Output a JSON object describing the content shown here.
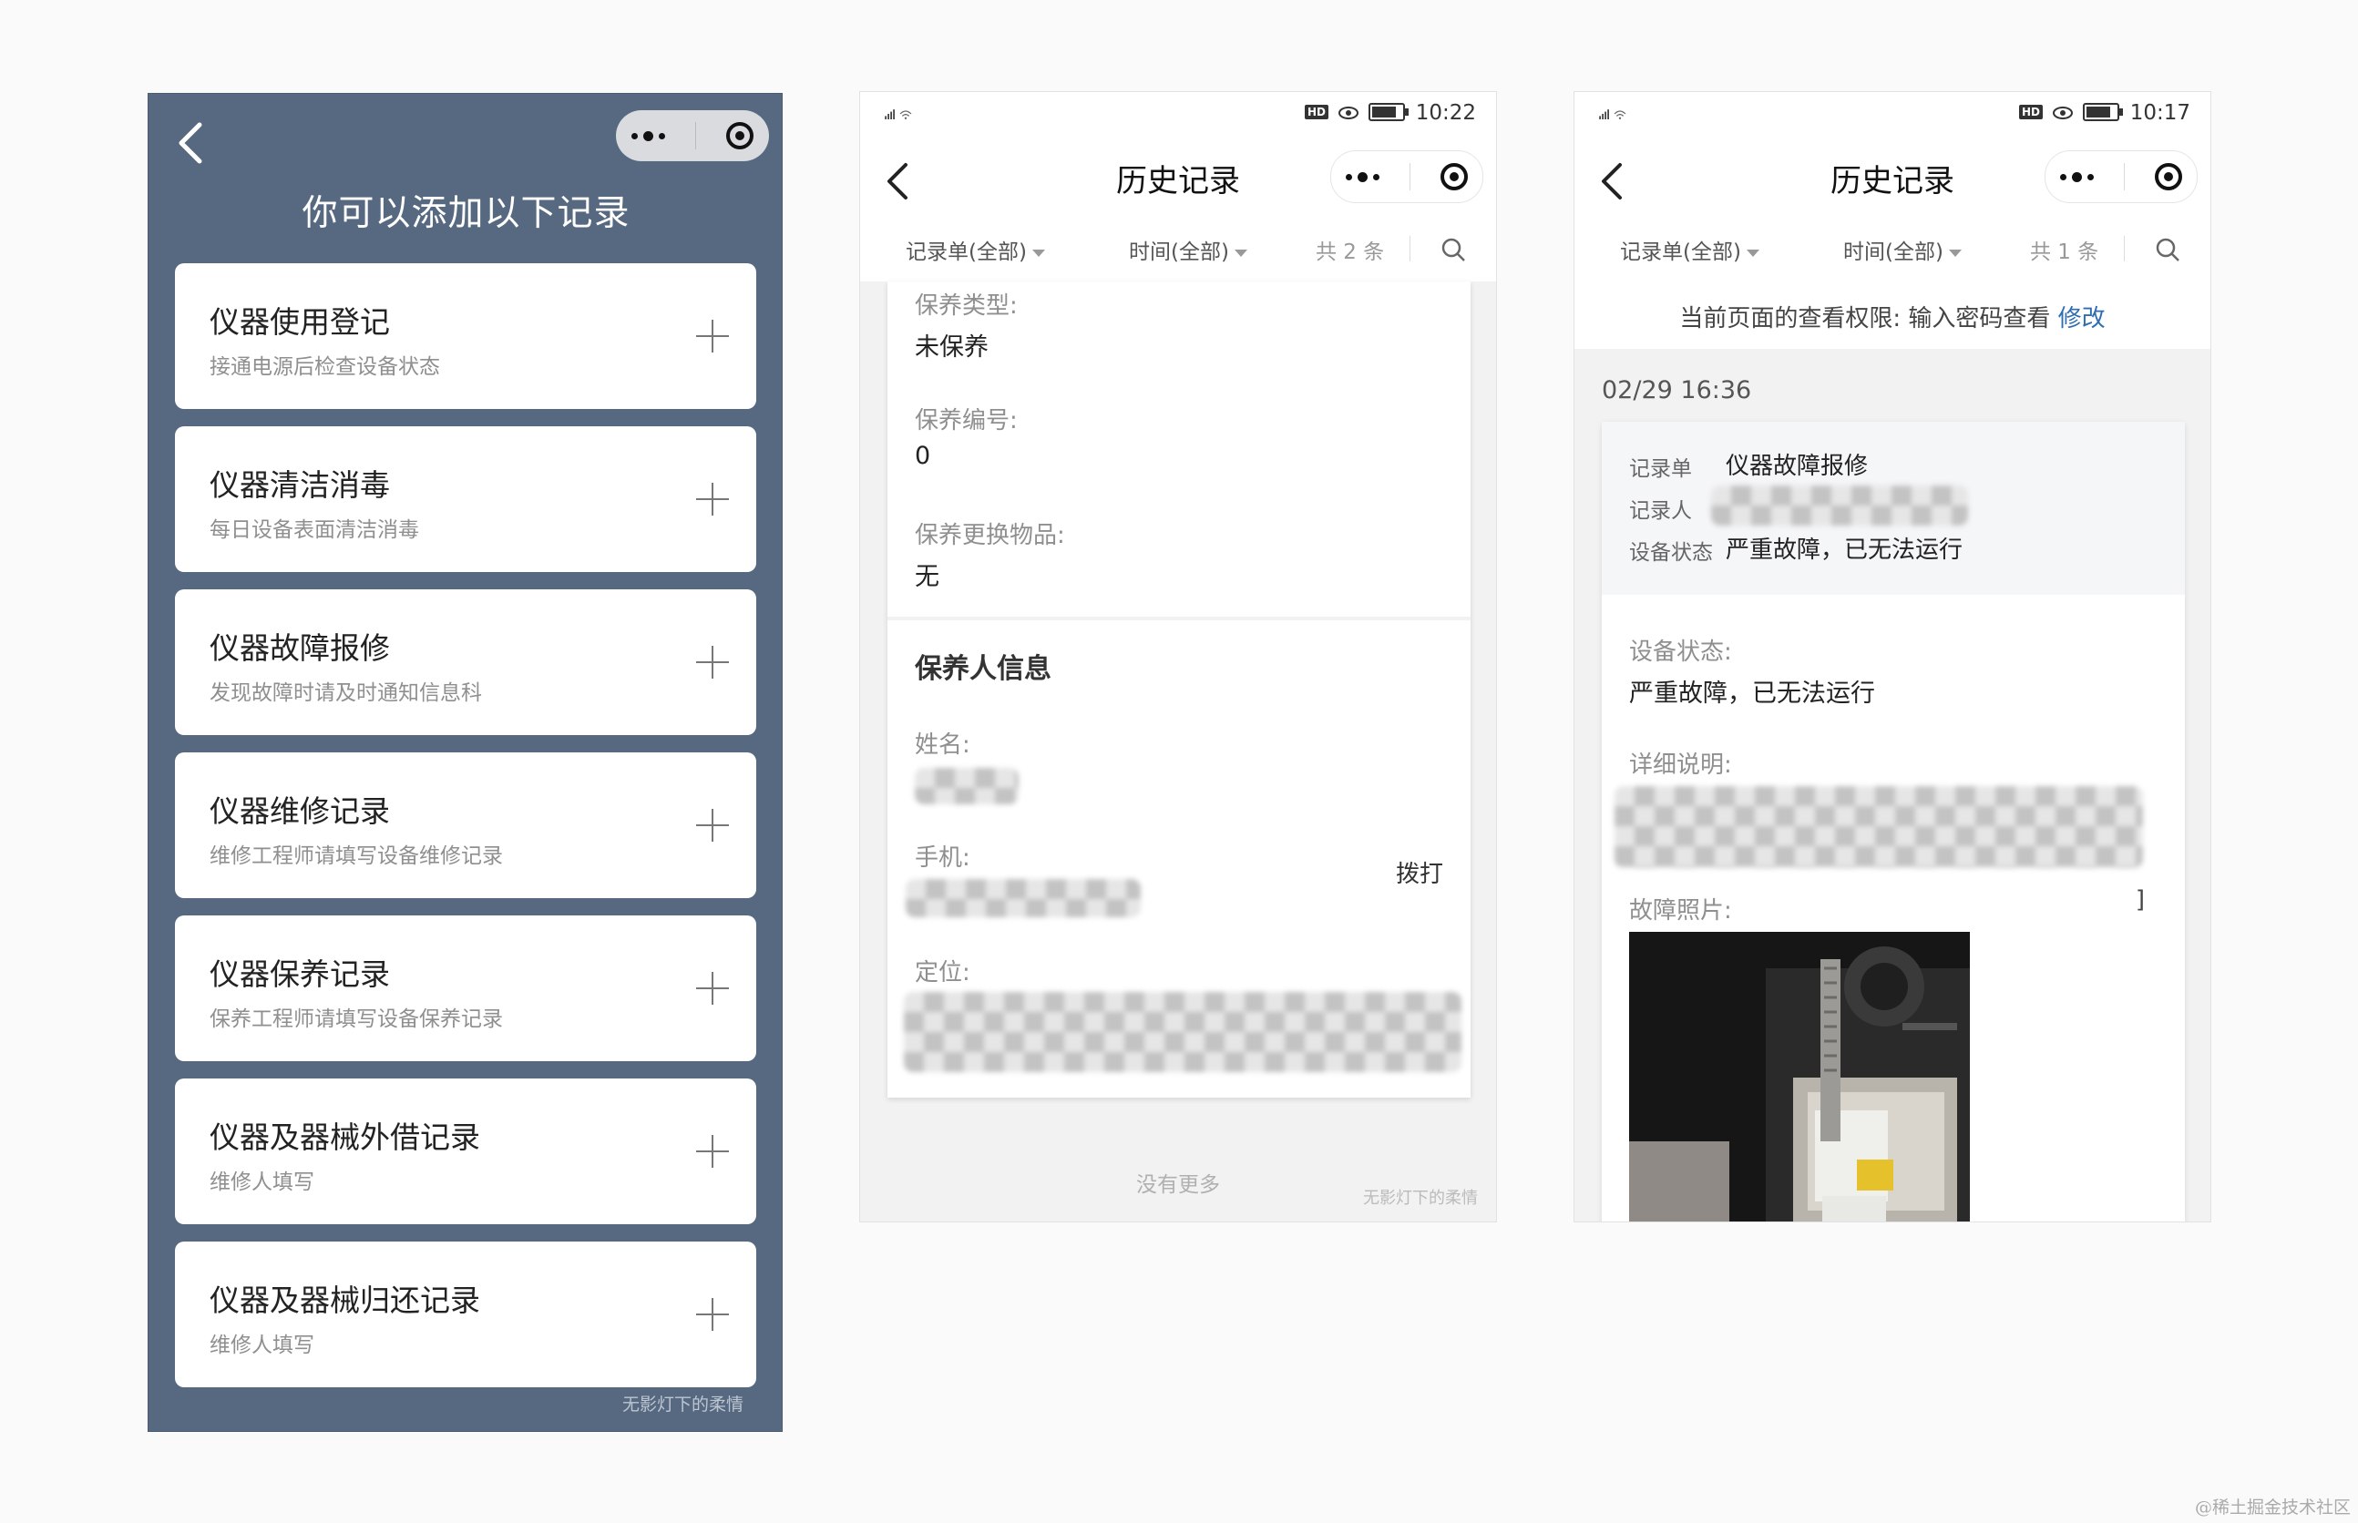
{
  "panel1": {
    "title": "你可以添加以下记录",
    "cards": [
      {
        "title": "仪器使用登记",
        "subtitle": "接通电源后检查设备状态"
      },
      {
        "title": "仪器清洁消毒",
        "subtitle": "每日设备表面清洁消毒"
      },
      {
        "title": "仪器故障报修",
        "subtitle": "发现故障时请及时通知信息科"
      },
      {
        "title": "仪器维修记录",
        "subtitle": "维修工程师请填写设备维修记录"
      },
      {
        "title": "仪器保养记录",
        "subtitle": "保养工程师请填写设备保养记录"
      },
      {
        "title": "仪器及器械外借记录",
        "subtitle": "维修人填写"
      },
      {
        "title": "仪器及器械归还记录",
        "subtitle": "维修人填写"
      }
    ],
    "watermark": "无影灯下的柔情"
  },
  "panel2": {
    "status_time": "10:22",
    "nav_title": "历史记录",
    "filters": {
      "record": "记录单(全部)",
      "time": "时间(全部)",
      "count": "共 2 条"
    },
    "fields": [
      {
        "label": "保养类型:",
        "value": "未保养"
      },
      {
        "label": "保养编号:",
        "value": "0"
      },
      {
        "label": "保养更换物品:",
        "value": "无"
      }
    ],
    "section_title": "保养人信息",
    "person": {
      "name_label": "姓名:",
      "phone_label": "手机:",
      "location_label": "定位:",
      "dial": "拨打"
    },
    "no_more": "没有更多",
    "watermark": "无影灯下的柔情"
  },
  "panel3": {
    "status_time": "10:17",
    "nav_title": "历史记录",
    "filters": {
      "record": "记录单(全部)",
      "time": "时间(全部)",
      "count": "共 1 条"
    },
    "permission": {
      "text": "当前页面的查看权限: 输入密码查看 ",
      "link": "修改"
    },
    "date": "02/29 16:36",
    "summary": [
      {
        "label": "记录单",
        "value": "仪器故障报修"
      },
      {
        "label": "记录人",
        "value": ""
      },
      {
        "label": "设备状态",
        "value": "严重故障，已无法运行"
      }
    ],
    "fields": [
      {
        "label": "设备状态:",
        "value": "严重故障，已无法运行"
      },
      {
        "label": "详细说明:",
        "value": ""
      },
      {
        "label": "故障照片:",
        "value": ""
      }
    ]
  },
  "site_watermark": "@稀土掘金技术社区",
  "colors": {
    "panel1_bg": "#566981",
    "link": "#2f6db3"
  }
}
